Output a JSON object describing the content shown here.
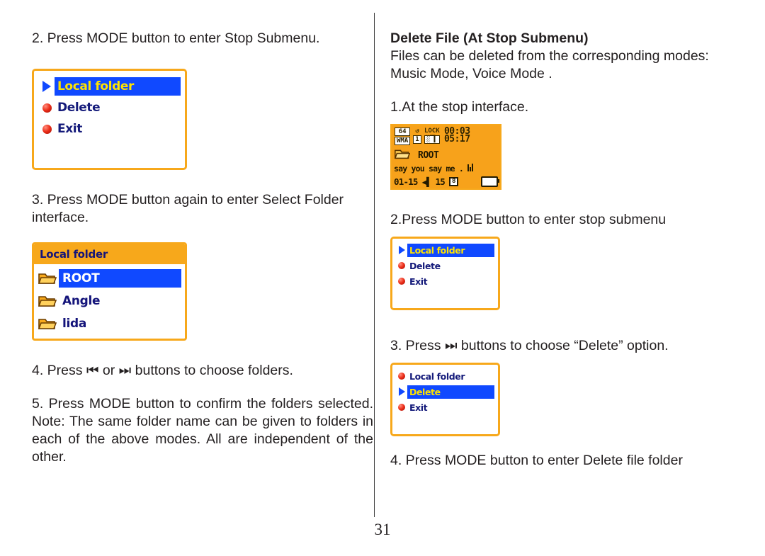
{
  "document": {
    "page_number": "31"
  },
  "left_column": {
    "step2_text": "2. Press MODE button to enter Stop Submenu.",
    "step3_text": "3. Press MODE button again to enter Select Folder interface.",
    "step4_text": "4. Press ⏮ or ⏭ buttons to choose folders.",
    "step5_text": "5. Press MODE button to confirm the folders selected.  Note: The same folder name can be given to folders in each of the above modes.  All are independent of the other.",
    "stop_submenu_lcd": {
      "name": "stop-submenu-screen",
      "items": [
        {
          "label": "Local folder",
          "marker": "cursor-triangle",
          "selected": true
        },
        {
          "label": "Delete",
          "marker": "bullet-dot",
          "selected": false
        },
        {
          "label": "Exit",
          "marker": "bullet-dot",
          "selected": false
        }
      ]
    },
    "folder_browser_lcd": {
      "name": "select-folder-screen",
      "title": "Local folder",
      "items": [
        {
          "label": "ROOT",
          "icon": "folder-icon",
          "selected": true
        },
        {
          "label": "Angle",
          "icon": "folder-icon",
          "selected": false
        },
        {
          "label": "lida",
          "icon": "folder-icon",
          "selected": false
        }
      ]
    }
  },
  "right_column": {
    "heading": "Delete File (At Stop Submenu)",
    "intro_text": "Files can be deleted from the corresponding modes: Music Mode, Voice Mode .",
    "step1_text": "1.At the stop interface.",
    "step2_text": "2.Press MODE button to enter stop submenu",
    "step3_text": "3. Press ⏭ buttons to choose “Delete” option.",
    "step4_text": "4. Press MODE button to enter Delete file folder",
    "stop_interface_lcd": {
      "name": "stop-interface-screen",
      "bitrate": "64",
      "format": "WMA",
      "repeat_mode": "repeat-one-icon",
      "repeat_badge": "1",
      "lock_label": "LOCK",
      "eq_icon": "equalizer-icon",
      "elapsed_time": "00:03",
      "total_time": "05:17",
      "folder_name": "ROOT",
      "track_title": "say you say me .",
      "track_indicator": "playing-bars-icon",
      "track_number": "01-15",
      "volume_icon": "volume-icon",
      "volume_level": "15",
      "eq_badge": "8",
      "battery_icon": "battery-icon"
    },
    "submenu_lcd": {
      "name": "stop-submenu-screen-right",
      "items": [
        {
          "label": "Local folder",
          "marker": "cursor-triangle",
          "selected": true
        },
        {
          "label": "Delete",
          "marker": "bullet-dot",
          "selected": false
        },
        {
          "label": "Exit",
          "marker": "bullet-dot",
          "selected": false
        }
      ]
    },
    "delete_selected_lcd": {
      "name": "delete-option-selected-screen",
      "items": [
        {
          "label": "Local folder",
          "marker": "bullet-dot",
          "selected": false
        },
        {
          "label": "Delete",
          "marker": "cursor-triangle",
          "selected": true
        },
        {
          "label": "Exit",
          "marker": "bullet-dot",
          "selected": false
        }
      ]
    }
  },
  "colors": {
    "lcd_border": "#f7a81b",
    "lcd_backlight": "#f7a21b",
    "selection_blue": "#1049ff",
    "selection_yellow": "#ffe400",
    "menu_text": "#141a7a"
  }
}
